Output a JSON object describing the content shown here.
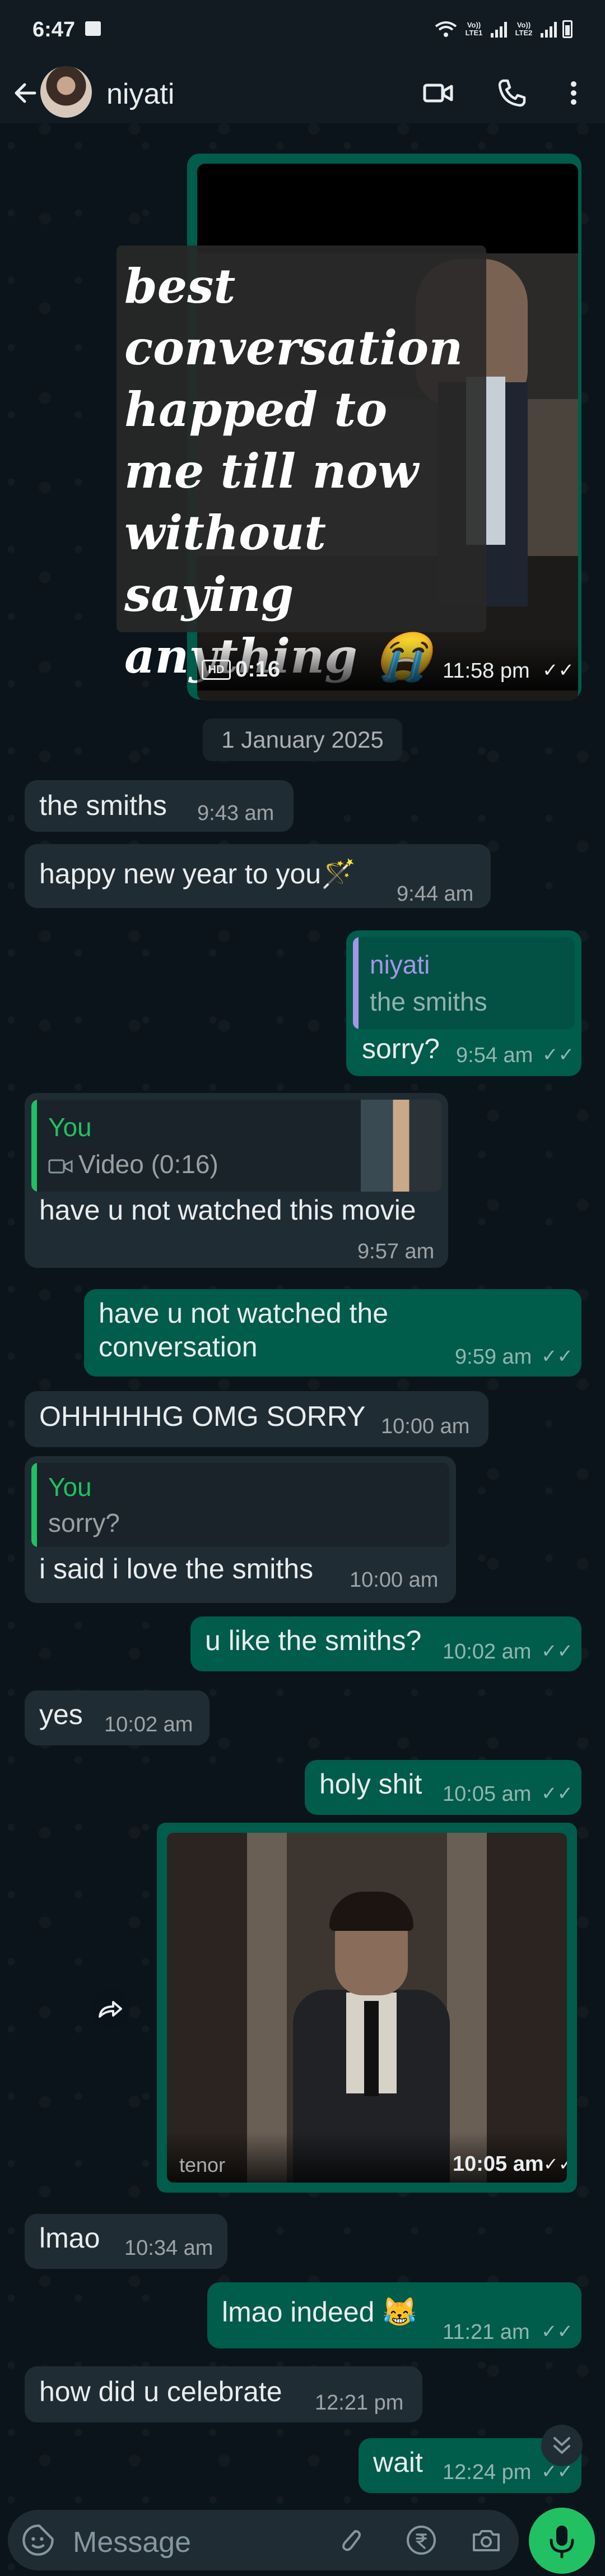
{
  "status_bar": {
    "time": "6:47",
    "sim1": "Vo)) LTE1",
    "sim2": "Vo)) LTE2"
  },
  "header": {
    "contact_name": "niyati"
  },
  "messages": {
    "m1": {
      "overlay_text": "best conversation happed to me till now without saying anything 😭",
      "duration": "0:16",
      "badge": "HD",
      "time": "11:58 pm"
    },
    "date_divider": "1 January 2025",
    "m2": {
      "text": "the smiths",
      "time": "9:43 am"
    },
    "m3": {
      "text": "happy new year to you🪄",
      "time": "9:44 am"
    },
    "m4": {
      "quote_name": "niyati",
      "quote_text": "the smiths",
      "text": "sorry?",
      "time": "9:54 am"
    },
    "m5": {
      "quote_name": "You",
      "quote_text": "Video (0:16)",
      "text": "have u not watched this movie",
      "time": "9:57 am"
    },
    "m6": {
      "line1": "have u not watched the",
      "line2": "conversation",
      "time": "9:59 am"
    },
    "m7": {
      "text": "OHHHHHG OMG SORRY",
      "time": "10:00 am"
    },
    "m8": {
      "quote_name": "You",
      "quote_text": "sorry?",
      "text": "i said i love the smiths",
      "time": "10:00 am"
    },
    "m9": {
      "text": "u like the smiths?",
      "time": "10:02 am"
    },
    "m10": {
      "text": "yes",
      "time": "10:02 am"
    },
    "m11": {
      "text": "holy shit",
      "time": "10:05 am"
    },
    "m12": {
      "watermark": "tenor",
      "time": "10:05 am"
    },
    "m13": {
      "text": "lmao",
      "time": "10:34 am"
    },
    "m14": {
      "text": "lmao indeed 😹",
      "time": "11:21 am"
    },
    "m15": {
      "text": "how did u celebrate",
      "time": "12:21 pm"
    },
    "m16": {
      "text": "wait",
      "time": "12:24 pm"
    }
  },
  "composer": {
    "placeholder": "Message"
  },
  "colors": {
    "incoming_bubble": "#202c33",
    "outgoing_bubble": "#005c4b",
    "accent": "#21c063",
    "background": "#0b141a"
  }
}
